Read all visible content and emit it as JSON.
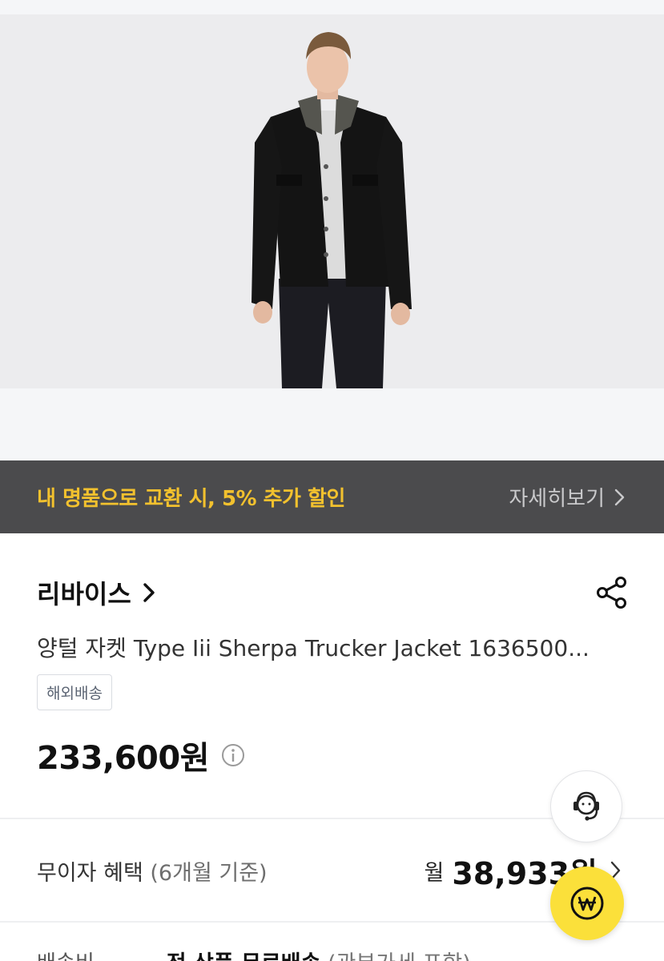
{
  "promo": {
    "text": "내 명품으로 교환 시, 5% 추가 할인",
    "link_label": "자세히보기"
  },
  "product": {
    "brand": "리바이스",
    "title": "양털 자켓 Type Iii Sherpa Trucker Jacket 1636500...",
    "badge": "해외배송",
    "price": "233,600원"
  },
  "installment": {
    "label": "무이자 혜택",
    "sub_label": "(6개월 기준)",
    "month_prefix": "월",
    "amount": "38,933원"
  },
  "shipping": {
    "label": "배송비",
    "value": "전 상품 무료배송",
    "sub_value": "(관부가세 포함)"
  },
  "icons": {
    "share": "share-icon",
    "info": "info-icon",
    "customer_service": "headset-icon",
    "pay": "won-icon"
  },
  "colors": {
    "promo_bg": "#4b4b4d",
    "promo_text": "#f2c12e",
    "pay_button": "#fbe03a"
  }
}
